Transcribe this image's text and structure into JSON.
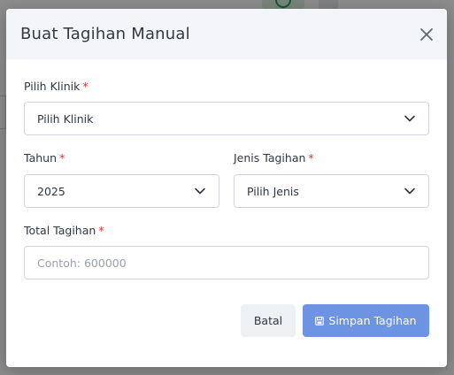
{
  "modal": {
    "title": "Buat Tagihan Manual",
    "klinik": {
      "label": "Pilih Klinik",
      "required_mark": "*",
      "value": "Pilih Klinik"
    },
    "tahun": {
      "label": "Tahun",
      "required_mark": "*",
      "value": "2025"
    },
    "jenis": {
      "label": "Jenis Tagihan",
      "required_mark": "*",
      "value": "Pilih Jenis"
    },
    "total": {
      "label": "Total Tagihan",
      "required_mark": "*",
      "placeholder": "Contoh: 600000",
      "value": ""
    },
    "buttons": {
      "cancel": "Batal",
      "save": "Simpan Tagihan"
    }
  },
  "colors": {
    "primary_button": "#6d94e3",
    "required_mark": "#e03131",
    "header_bg": "#f3f5f8"
  },
  "icons": {
    "close": "close-icon",
    "dropdown": "chevron-down-icon",
    "save": "save-icon"
  }
}
